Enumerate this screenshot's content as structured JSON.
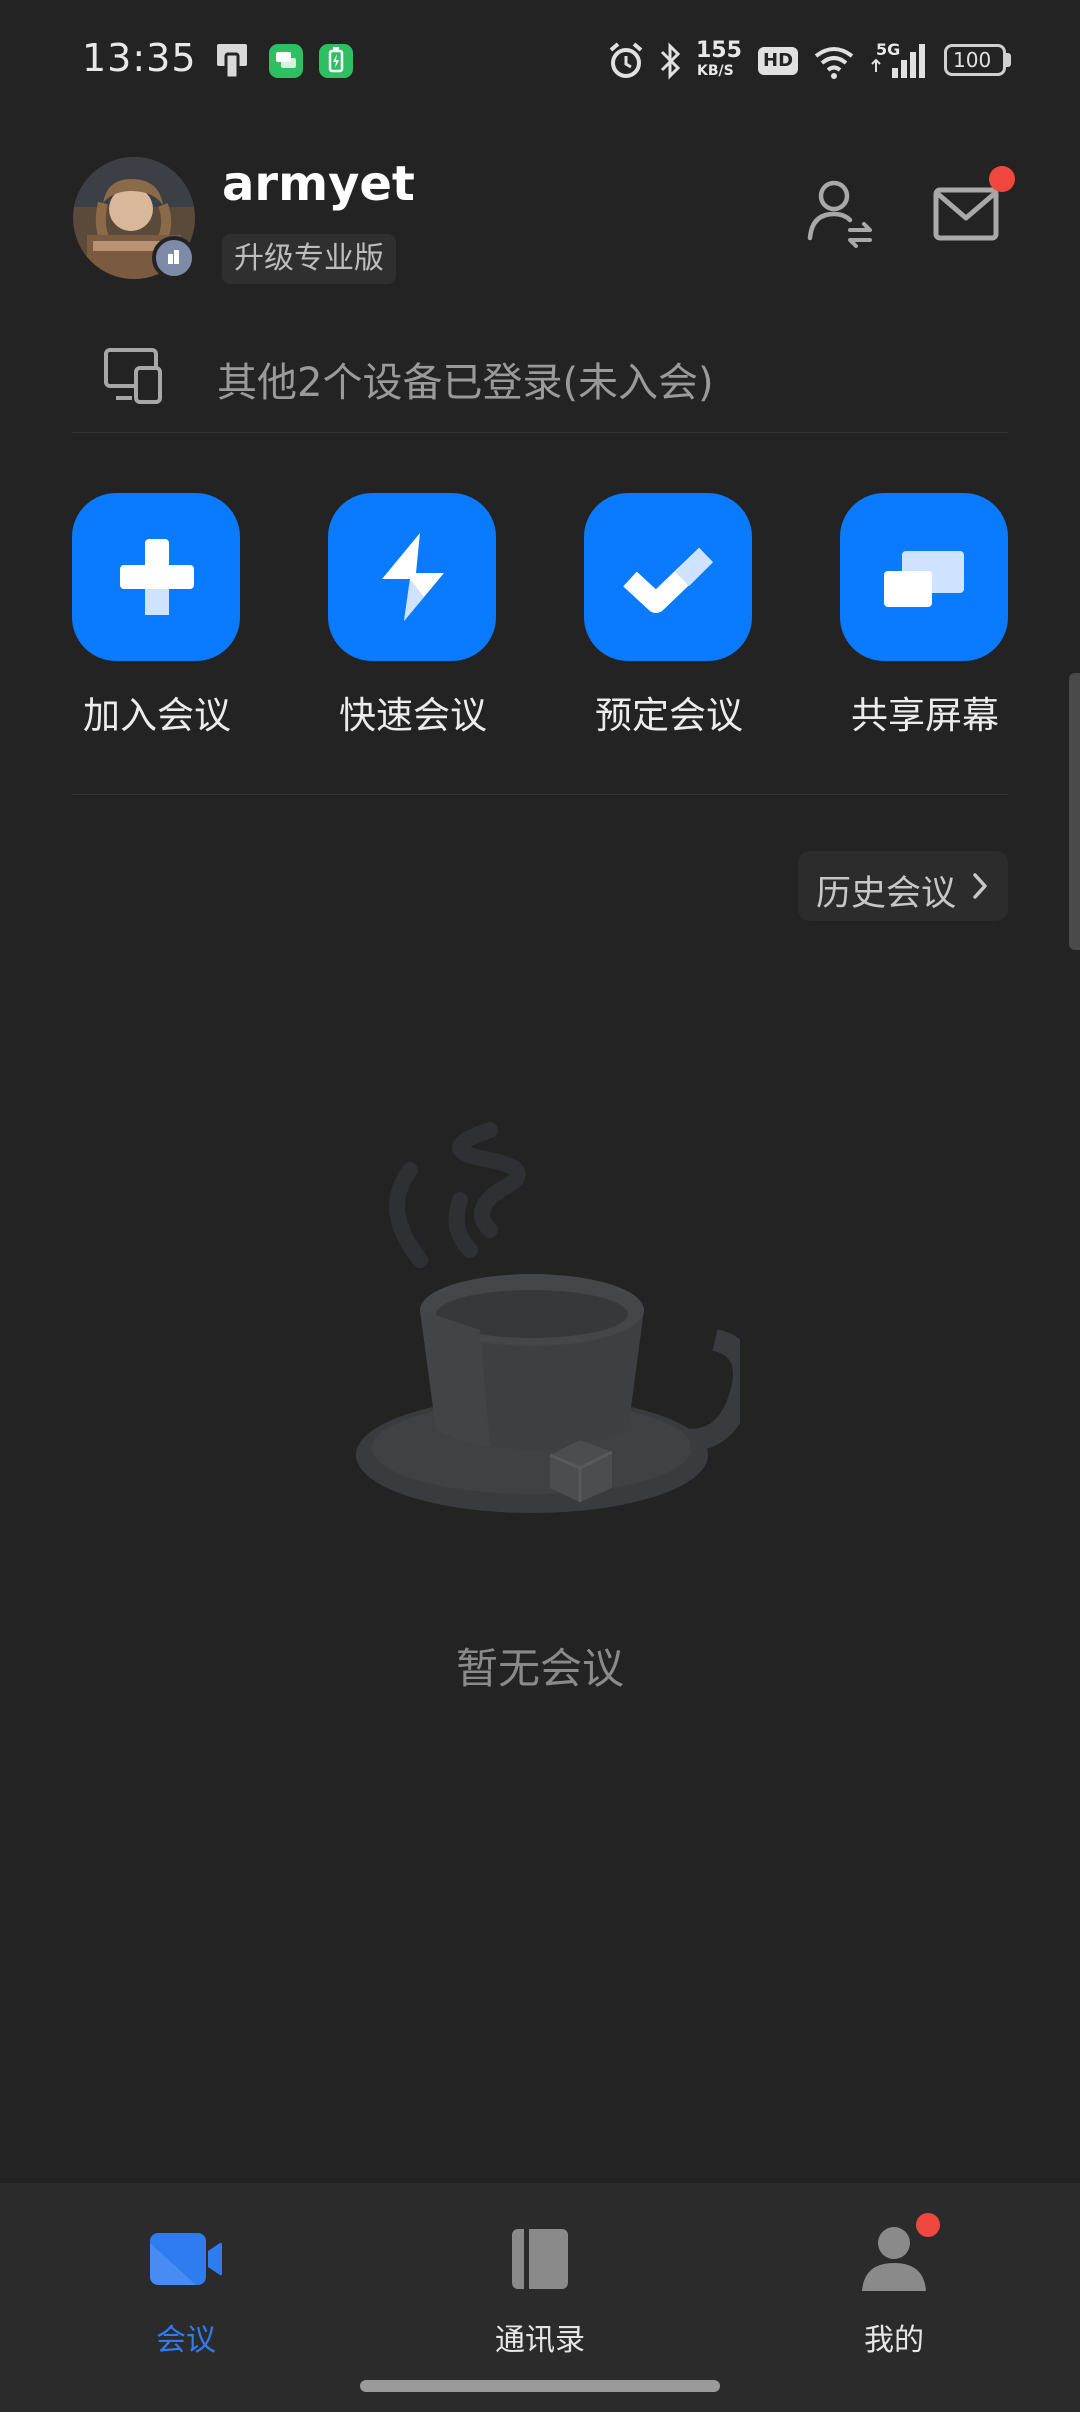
{
  "status_bar": {
    "time": "13:35",
    "net_speed_value": "155",
    "net_speed_unit": "KB/S",
    "hd_label": "HD",
    "network_label": "5G",
    "battery_level": "100"
  },
  "header": {
    "username": "armyet",
    "upgrade_label": "升级专业版"
  },
  "devices_notice": "其他2个设备已登录(未入会)",
  "actions": [
    {
      "label": "加入会议",
      "icon": "plus-icon"
    },
    {
      "label": "快速会议",
      "icon": "lightning-icon"
    },
    {
      "label": "预定会议",
      "icon": "check-icon"
    },
    {
      "label": "共享屏幕",
      "icon": "share-screen-icon"
    }
  ],
  "history_button": "历史会议",
  "empty_state": "暂无会议",
  "bottom_nav": [
    {
      "label": "会议",
      "icon": "video-camera-icon",
      "active": true
    },
    {
      "label": "通讯录",
      "icon": "contacts-book-icon",
      "active": false
    },
    {
      "label": "我的",
      "icon": "person-icon",
      "active": false
    }
  ],
  "colors": {
    "background": "#232323",
    "accent": "#0a7bff",
    "active_tab": "#2f7bf0",
    "badge_red": "#f0483e"
  }
}
